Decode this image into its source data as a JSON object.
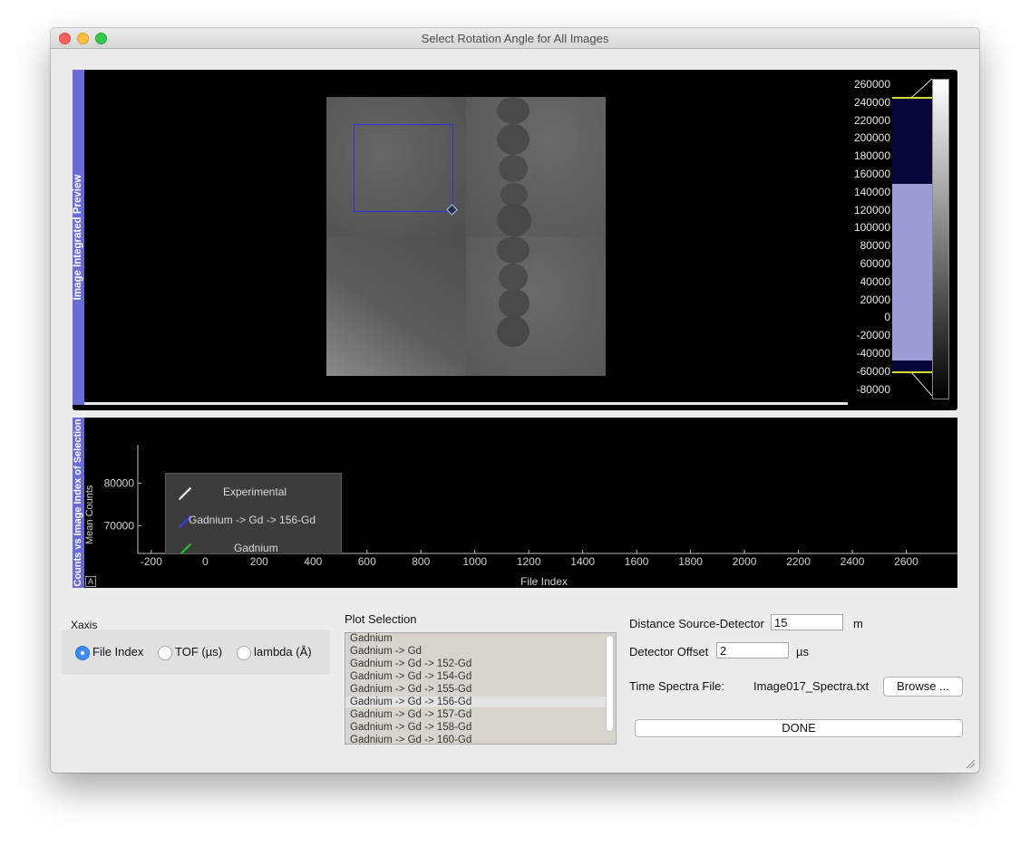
{
  "window": {
    "title": "Select Rotation Angle for All Images"
  },
  "preview": {
    "tab_label": "Image Integrated Preview",
    "colorbar_ticks": [
      "260000",
      "240000",
      "220000",
      "200000",
      "180000",
      "160000",
      "140000",
      "120000",
      "100000",
      "80000",
      "60000",
      "40000",
      "20000",
      "0",
      "-20000",
      "-40000",
      "-60000",
      "-80000"
    ]
  },
  "plot": {
    "tab_label": "Counts vs Image Index of Selection",
    "ylabel": "Mean Counts",
    "autoscale_label": "A",
    "chart_data": {
      "type": "line",
      "xlabel": "File Index",
      "ylabel": "Mean Counts",
      "x_ticks": [
        -200,
        0,
        200,
        400,
        600,
        800,
        1000,
        1200,
        1400,
        1600,
        1800,
        2000,
        2200,
        2400,
        2600
      ],
      "y_ticks": [
        70000,
        80000
      ],
      "xlim": [
        -250,
        2790
      ],
      "ylim": [
        63500,
        89000
      ],
      "legend": [
        "Experimental",
        "Gadnium -> Gd -> 156-Gd",
        "Gadnium"
      ]
    }
  },
  "colors": {
    "tab": "#6a6ad8",
    "roi": "#2f33e6",
    "experimental": "#ffffff",
    "gd156": "#3b3bff",
    "gadnium": "#29c729"
  },
  "xaxis": {
    "label": "Xaxis",
    "options": [
      {
        "label": "File Index",
        "selected": true
      },
      {
        "label": "TOF (µs)",
        "selected": false
      },
      {
        "label": "lambda (Å)",
        "selected": false
      }
    ]
  },
  "plot_selection": {
    "label": "Plot Selection",
    "items": [
      "Gadnium",
      "Gadnium -> Gd",
      "Gadnium -> Gd -> 152-Gd",
      "Gadnium -> Gd -> 154-Gd",
      "Gadnium -> Gd -> 155-Gd",
      "Gadnium -> Gd -> 156-Gd",
      "Gadnium -> Gd -> 157-Gd",
      "Gadnium -> Gd -> 158-Gd",
      "Gadnium -> Gd -> 160-Gd"
    ],
    "selected_index": 5
  },
  "settings": {
    "distance_label": "Distance Source-Detector",
    "distance_value": "15",
    "distance_unit": "m",
    "offset_label": "Detector Offset",
    "offset_value": "2",
    "offset_unit": "µs",
    "spectra_label": "Time Spectra File:",
    "spectra_file": "Image017_Spectra.txt",
    "browse_label": "Browse ...",
    "done_label": "DONE"
  }
}
